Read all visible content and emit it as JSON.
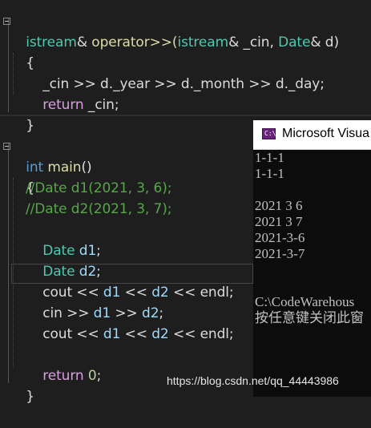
{
  "editor": {
    "block1": {
      "signature": {
        "t1": "istream",
        "amp1": "&",
        "op": " operator>>(",
        "t2": "istream",
        "amp2": "& _cin, ",
        "t3": "Date",
        "amp3": "& d)"
      },
      "open_brace": "{",
      "line_read": {
        "a": "_cin >> d.",
        "f1": "_year",
        "b": " >> d.",
        "f2": "_month",
        "c": " >> d.",
        "f3": "_day",
        "d": ";"
      },
      "line_return": {
        "kw": "return",
        "rest": " _cin;"
      },
      "close_brace": "}"
    },
    "block2": {
      "signature": {
        "kw": "int",
        "name": " main",
        "rest": "()"
      },
      "open_brace": "{",
      "comment1": "//Date d1(2021, 3, 6);",
      "comment2": "//Date d2(2021, 3, 7);",
      "decl1": {
        "type": "Date",
        "var": " d1",
        "end": ";"
      },
      "decl2": {
        "type": "Date",
        "var": " d2",
        "end": ";"
      },
      "cout1": {
        "a": "cout << ",
        "v1": "d1",
        "b": " << ",
        "v2": "d2",
        "c": " << ",
        "e": "endl",
        "d": ";"
      },
      "cin": {
        "a": "cin >> ",
        "v1": "d1",
        "b": " >> ",
        "v2": "d2",
        "d": ";"
      },
      "cout2": {
        "a": "cout << ",
        "v1": "d1",
        "b": " << ",
        "v2": "d2",
        "c": " << ",
        "e": "endl",
        "d": ";"
      },
      "return": {
        "kw": "return",
        "sp": " ",
        "num": "0",
        "end": ";"
      },
      "close_brace": "}"
    }
  },
  "console": {
    "icon": "C:\\",
    "title": "Microsoft Visua",
    "lines": [
      "1-1-1",
      "1-1-1",
      "",
      "2021 3 6",
      "2021 3 7",
      "2021-3-6",
      "2021-3-7",
      "",
      "",
      "C:\\CodeWarehous",
      "按任意键关闭此窗"
    ]
  },
  "watermark": "https://blog.csdn.net/qq_44443986",
  "colors": {
    "background": "#1e1e1e",
    "keyword": "#569cd6",
    "control_keyword": "#d8a0df",
    "type": "#4ec9b0",
    "function": "#dcdcaa",
    "variable": "#9cdcfe",
    "comment": "#57a64a",
    "number": "#b5cea8",
    "console_bg": "#0c0c0c"
  }
}
